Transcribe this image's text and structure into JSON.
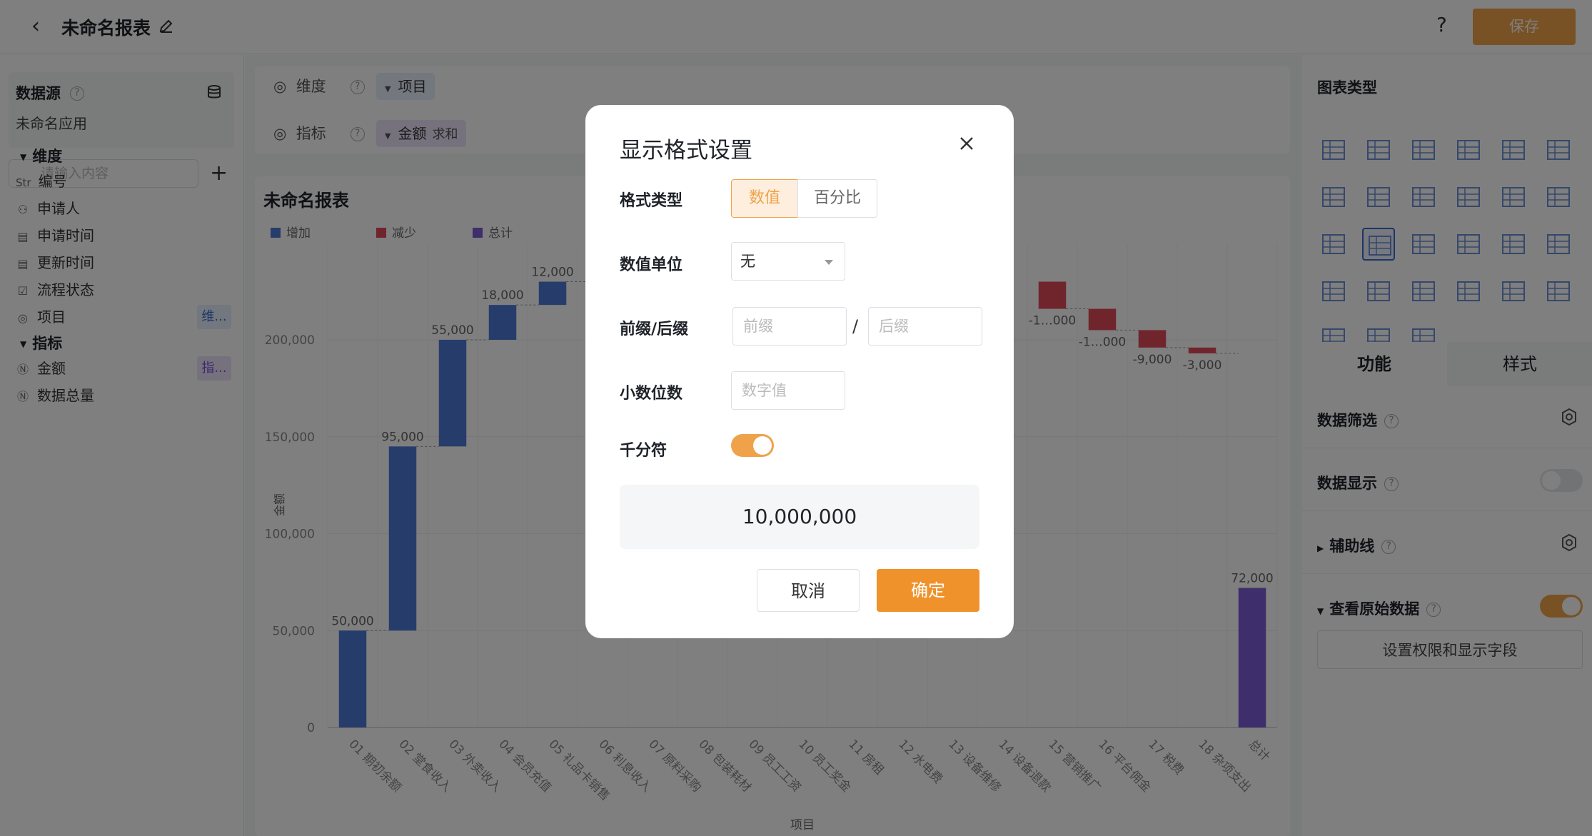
{
  "header": {
    "title": "未命名报表",
    "save_label": "保存",
    "help_label": "?"
  },
  "left": {
    "datasource_title": "数据源",
    "datasource_app": "未命名应用",
    "search_placeholder": "请输入内容",
    "dims_title": "维度",
    "metrics_title": "指标",
    "dims": [
      {
        "icon": "Str",
        "label": "编号"
      },
      {
        "icon": "person",
        "label": "申请人"
      },
      {
        "icon": "calendar",
        "label": "申请时间"
      },
      {
        "icon": "calendar",
        "label": "更新时间"
      },
      {
        "icon": "checkbox",
        "label": "流程状态"
      },
      {
        "icon": "radio",
        "label": "项目",
        "tag": "维..."
      }
    ],
    "metrics": [
      {
        "icon": "N",
        "label": "金额",
        "tag": "指..."
      },
      {
        "icon": "N",
        "label": "数据总量"
      }
    ]
  },
  "fields": {
    "dim_label": "维度",
    "dim_pill": "项目",
    "metric_label": "指标",
    "metric_pill": "金额",
    "metric_agg": "求和"
  },
  "chart_data": {
    "type": "bar",
    "subtype": "waterfall",
    "title": "未命名报表",
    "xlabel": "项目",
    "ylabel": "金额",
    "ylim": [
      0,
      200000
    ],
    "yticks": [
      "0",
      "50,000",
      "100,000",
      "150,000",
      "200,000"
    ],
    "legend": [
      "增加",
      "减少",
      "总计"
    ],
    "colors": {
      "increase": "#4c7bd9",
      "decrease": "#e14b5a",
      "total": "#7c5cd6"
    },
    "categories": [
      "01 期初余额",
      "02 堂食收入",
      "03 外卖收入",
      "04 会员充值",
      "05 礼品卡销售",
      "06 利息收入",
      "07 原料采购",
      "08 包装耗材",
      "09 员工工资",
      "10 员工奖金",
      "11 房租",
      "12 水电费",
      "13 设备维修",
      "14 设备退款",
      "15 营销推广",
      "16 平台佣金",
      "17 税费",
      "18 杂项支出",
      "总计"
    ],
    "values": [
      50000,
      95000,
      55000,
      18000,
      12000,
      null,
      null,
      null,
      null,
      null,
      null,
      null,
      null,
      null,
      -14000,
      -11000,
      -9000,
      -3000,
      72000
    ],
    "visible_labels": {
      "01 期初余额": "50,000",
      "02 堂食收入": "95,000",
      "03 外卖收入": "55,000",
      "04 会员充值": "18,000",
      "05 礼品卡销售": "12,000",
      "15 营销推广": "-1…000",
      "16 平台佣金": "-1…000",
      "17 税费": "-9,000",
      "18 杂项支出": "-3,000",
      "总计": "72,000"
    }
  },
  "right": {
    "chart_type_title": "图表类型",
    "tab_function": "功能",
    "tab_style": "样式",
    "data_filter": "数据筛选",
    "data_display": "数据显示",
    "aux_line": "辅助线",
    "view_raw": "查看原始数据",
    "perm_button": "设置权限和显示字段"
  },
  "modal": {
    "title": "显示格式设置",
    "format_type_label": "格式类型",
    "format_options": [
      "数值",
      "百分比"
    ],
    "format_selected": "数值",
    "unit_label": "数值单位",
    "unit_value": "无",
    "prefix_suffix_label": "前缀/后缀",
    "prefix_placeholder": "前缀",
    "suffix_placeholder": "后缀",
    "slash": "/",
    "decimals_label": "小数位数",
    "decimals_placeholder": "数字值",
    "thousands_label": "千分符",
    "thousands_on": true,
    "preview": "10,000,000",
    "cancel_label": "取消",
    "ok_label": "确定"
  }
}
